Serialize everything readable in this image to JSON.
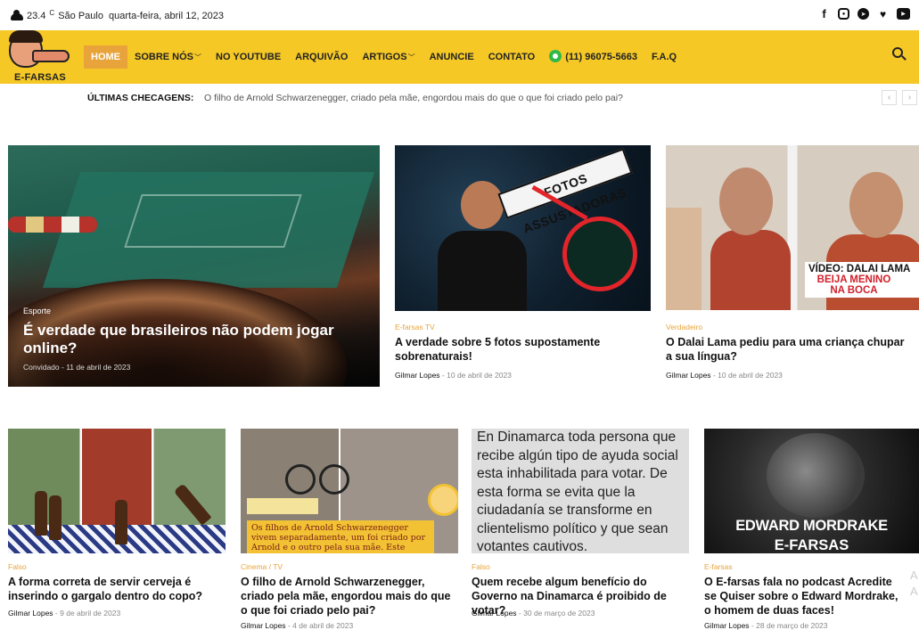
{
  "topbar": {
    "temperature": "23.4",
    "temp_unit": "C",
    "city": "São Paulo",
    "date": "quarta-feira, abril 12, 2023",
    "social_icons": [
      "facebook-icon",
      "instagram-icon",
      "telegram-icon",
      "twitter-icon",
      "youtube-icon"
    ]
  },
  "brand": {
    "logo_text": "E-FARSAS",
    "accent_color": "#f5c826",
    "active_color": "#e8a43a"
  },
  "nav": {
    "items": [
      {
        "label": "HOME",
        "active": true,
        "dropdown": false
      },
      {
        "label": "SOBRE NÓS",
        "active": false,
        "dropdown": true
      },
      {
        "label": "NO YOUTUBE",
        "active": false,
        "dropdown": false
      },
      {
        "label": "ARQUIVÃO",
        "active": false,
        "dropdown": false
      },
      {
        "label": "ARTIGOS",
        "active": false,
        "dropdown": true
      },
      {
        "label": "ANUNCIE",
        "active": false,
        "dropdown": false
      },
      {
        "label": "CONTATO",
        "active": false,
        "dropdown": false
      },
      {
        "label": "(11) 96075-5663",
        "active": false,
        "dropdown": false,
        "icon": "whatsapp-icon"
      },
      {
        "label": "F.A.Q",
        "active": false,
        "dropdown": false
      }
    ],
    "search_icon": "search-icon"
  },
  "ticker": {
    "label": "ÚLTIMAS CHECAGENS:",
    "text": "O filho de Arnold Schwarzenegger, criado pela mãe, engordou mais do que o que foi criado pelo pai?",
    "prev": "‹",
    "next": "›"
  },
  "featured": [
    {
      "category": "Esporte",
      "title": "É verdade que brasileiros não podem jogar online?",
      "author": "Convidado",
      "date": "11 de abril de 2023"
    },
    {
      "category": "E-farsas TV",
      "title": "A verdade sobre 5 fotos supostamente sobrenaturais!",
      "author": "Gilmar Lopes",
      "date": "10 de abril de 2023",
      "image_text": "FOTOS ASSUSTADORAS"
    },
    {
      "category": "Verdadeiro",
      "title": "O Dalai Lama pediu para uma criança chupar a sua língua?",
      "author": "Gilmar Lopes",
      "date": "10 de abril de 2023",
      "image_text": [
        "VÍDEO: DALAI LAMA",
        "BEIJA MENINO",
        "NA BOCA"
      ]
    }
  ],
  "articles": [
    {
      "category": "Falso",
      "title": "A forma correta de servir cerveja é inserindo o gargalo dentro do copo?",
      "author": "Gilmar Lopes",
      "date": "9 de abril de 2023"
    },
    {
      "category": "Cinema / TV",
      "title": "O filho de Arnold Schwarzenegger, criado pela mãe, engordou mais do que o que foi criado pelo pai?",
      "author": "Gilmar Lopes",
      "date": "4 de abril de 2023",
      "image_text": [
        "Os filhos de Arnold Schwarzenegger",
        "vivem separadamente, um foi criado por",
        "Arnold e o outro pela sua mãe. Este"
      ]
    },
    {
      "category": "Falso",
      "title": "Quem recebe algum benefício do Governo na Dinamarca é proibido de votar?",
      "author": "Gilmar Lopes",
      "date": "30 de março de 2023",
      "image_text": "En Dinamarca toda persona que recibe algún tipo de ayuda social esta inhabilitada para votar. De esta forma se evita que la ciudadanía se transforme en clientelismo político y que sean votantes cautivos."
    },
    {
      "category": "E-farsas",
      "title": "O E-farsas fala no podcast Acredite se Quiser sobre o Edward Mordrake, o homem de duas faces!",
      "author": "Gilmar Lopes",
      "date": "28 de março de 2023",
      "image_text": [
        "EDWARD MORDRAKE",
        "E-FARSAS"
      ]
    }
  ],
  "edge_letters": [
    "A",
    "A"
  ]
}
